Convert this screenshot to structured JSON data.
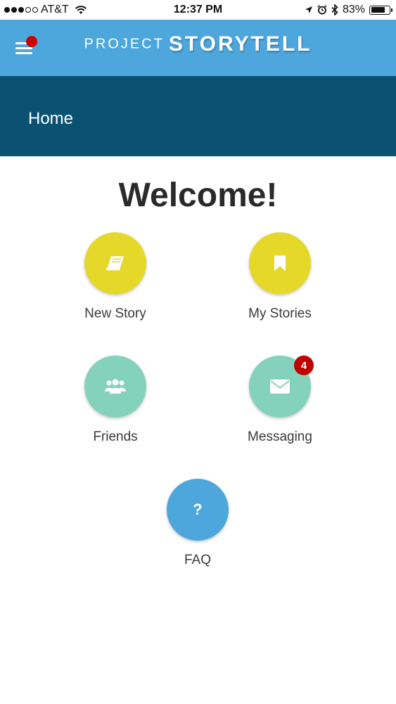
{
  "status_bar": {
    "carrier": "AT&T",
    "time": "12:37 PM",
    "battery_percent": "83%",
    "battery_level": 0.83,
    "signal_bars_filled": 3,
    "signal_bars_total": 5
  },
  "header": {
    "brand_part1": "PROJECT",
    "brand_part2": "STORYTELL",
    "menu_icon": "hamburger-menu-icon",
    "color": "#4da6dc"
  },
  "page": {
    "title": "Home",
    "title_bar_color": "#0b5272"
  },
  "main": {
    "welcome": "Welcome!",
    "tiles": [
      {
        "label": "New Story",
        "icon": "book-icon",
        "color": "#e5d829"
      },
      {
        "label": "My Stories",
        "icon": "bookmark-icon",
        "color": "#e5d829"
      },
      {
        "label": "Friends",
        "icon": "friends-icon",
        "color": "#84d2bc"
      },
      {
        "label": "Messaging",
        "icon": "envelope-icon",
        "color": "#84d2bc",
        "badge": "4"
      },
      {
        "label": "FAQ",
        "icon": "question-icon",
        "glyph": "?",
        "color": "#4da6dc"
      }
    ]
  }
}
